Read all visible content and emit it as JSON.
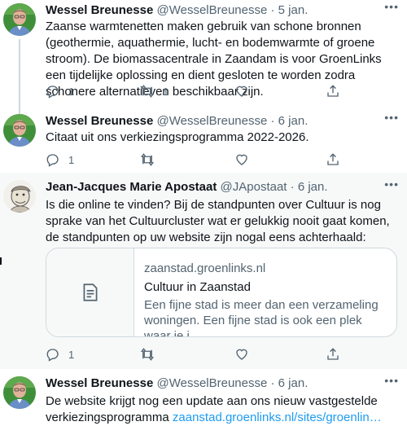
{
  "colors": {
    "accent": "#1d9bf0",
    "text": "#0f1419",
    "muted": "#536471",
    "border": "#cfd9de"
  },
  "tweets": [
    {
      "name": "Wessel Breunesse",
      "handle": "@WesselBreunesse",
      "time": "5 jan.",
      "text": "Zaanse warmtenetten maken gebruik van schone bronnen (geothermie, aquathermie, lucht- en bodemwarmte of groene stroom). De biomassacentrale in Zaandam is voor GroenLinks een tijdelijke oplossing en dient gesloten te worden zodra schonere alternatieven beschikbaar zijn.",
      "replies": "1",
      "retweets": "1",
      "likes": ""
    },
    {
      "name": "Wessel Breunesse",
      "handle": "@WesselBreunesse",
      "time": "6 jan.",
      "text": "Citaat uit ons verkiezingsprogramma 2022-2026.",
      "replies": "1",
      "retweets": "",
      "likes": ""
    },
    {
      "name": "Jean-Jacques Marie Apostaat",
      "handle": "@JApostaat",
      "time": "6 jan.",
      "text": "Is die online te vinden? Bij de standpunten over Cultuur is nog sprake van het Cultuurcluster wat er gelukkig nooit gaat komen, de standpunten op uw website zijn nogal eens achterhaald:",
      "card": {
        "domain": "zaanstad.groenlinks.nl",
        "title": "Cultuur in Zaanstad",
        "desc_line1": "Een fijne stad is meer dan een verzameling",
        "desc_line2": "woningen. Een fijne stad is ook een plek waar je j…"
      },
      "replies": "1",
      "retweets": "",
      "likes": ""
    },
    {
      "name": "Wessel Breunesse",
      "handle": "@WesselBreunesse",
      "time": "6 jan.",
      "text": "De website krijgt nog een update aan ons nieuw vastgestelde verkiezingsprogramma",
      "link": "zaanstad.groenlinks.nl/sites/groenlin…"
    }
  ],
  "icons": {
    "more": "more-icon",
    "reply": "reply-icon",
    "retweet": "retweet-icon",
    "like": "heart-icon",
    "share": "share-icon",
    "card_thumb": "document-icon"
  },
  "separator": "·"
}
